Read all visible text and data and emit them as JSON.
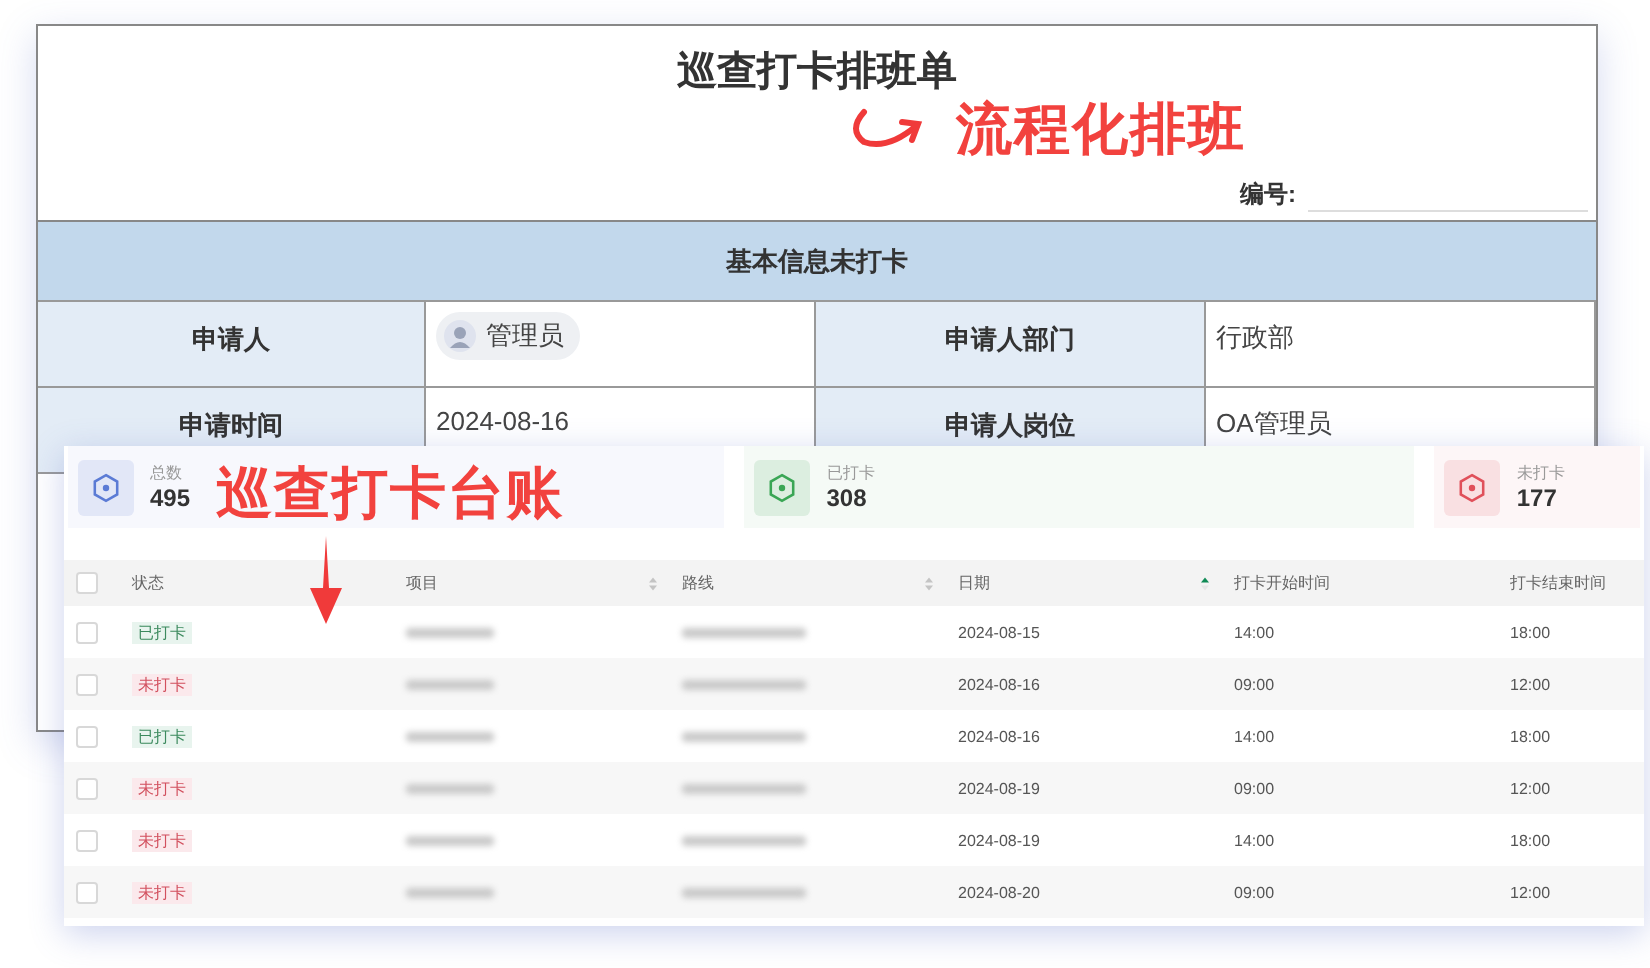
{
  "form": {
    "title": "巡查打卡排班单",
    "number_label": "编号:",
    "section": "基本信息未打卡",
    "rows": [
      {
        "label": "申请人",
        "value": "管理员",
        "kind": "user",
        "label2": "申请人部门",
        "value2": "行政部"
      },
      {
        "label": "申请时间",
        "value": "2024-08-16",
        "kind": "text",
        "label2": "申请人岗位",
        "value2": "OA管理员"
      }
    ]
  },
  "annotations": [
    {
      "text": "流程化排班",
      "kind": "curve"
    },
    {
      "text": "巡查打卡台账",
      "kind": "down"
    }
  ],
  "ledger": {
    "stats": [
      {
        "label": "总数",
        "value": "495",
        "color": "#5b7bd5"
      },
      {
        "label": "已打卡",
        "value": "308",
        "color": "#3aa655"
      },
      {
        "label": "未打卡",
        "value": "177",
        "color": "#e0505a"
      }
    ],
    "all_checked": false,
    "columns": [
      {
        "label": "状态",
        "sortable": false
      },
      {
        "label": "项目",
        "sortable": true,
        "sorted": false
      },
      {
        "label": "路线",
        "sortable": true,
        "sorted": false
      },
      {
        "label": "日期",
        "sortable": true,
        "sorted": true
      },
      {
        "label": "打卡开始时间",
        "sortable": false
      },
      {
        "label": "打卡结束时间",
        "sortable": false
      }
    ],
    "rows": [
      {
        "checked": false,
        "status": "已打卡",
        "kind": "done",
        "date": "2024-08-15",
        "start": "14:00",
        "end": "18:00"
      },
      {
        "checked": false,
        "status": "未打卡",
        "kind": "missed",
        "date": "2024-08-16",
        "start": "09:00",
        "end": "12:00"
      },
      {
        "checked": false,
        "status": "已打卡",
        "kind": "done",
        "date": "2024-08-16",
        "start": "14:00",
        "end": "18:00"
      },
      {
        "checked": false,
        "status": "未打卡",
        "kind": "missed",
        "date": "2024-08-19",
        "start": "09:00",
        "end": "12:00"
      },
      {
        "checked": false,
        "status": "未打卡",
        "kind": "missed",
        "date": "2024-08-19",
        "start": "14:00",
        "end": "18:00"
      },
      {
        "checked": false,
        "status": "未打卡",
        "kind": "missed",
        "date": "2024-08-20",
        "start": "09:00",
        "end": "12:00"
      }
    ]
  }
}
